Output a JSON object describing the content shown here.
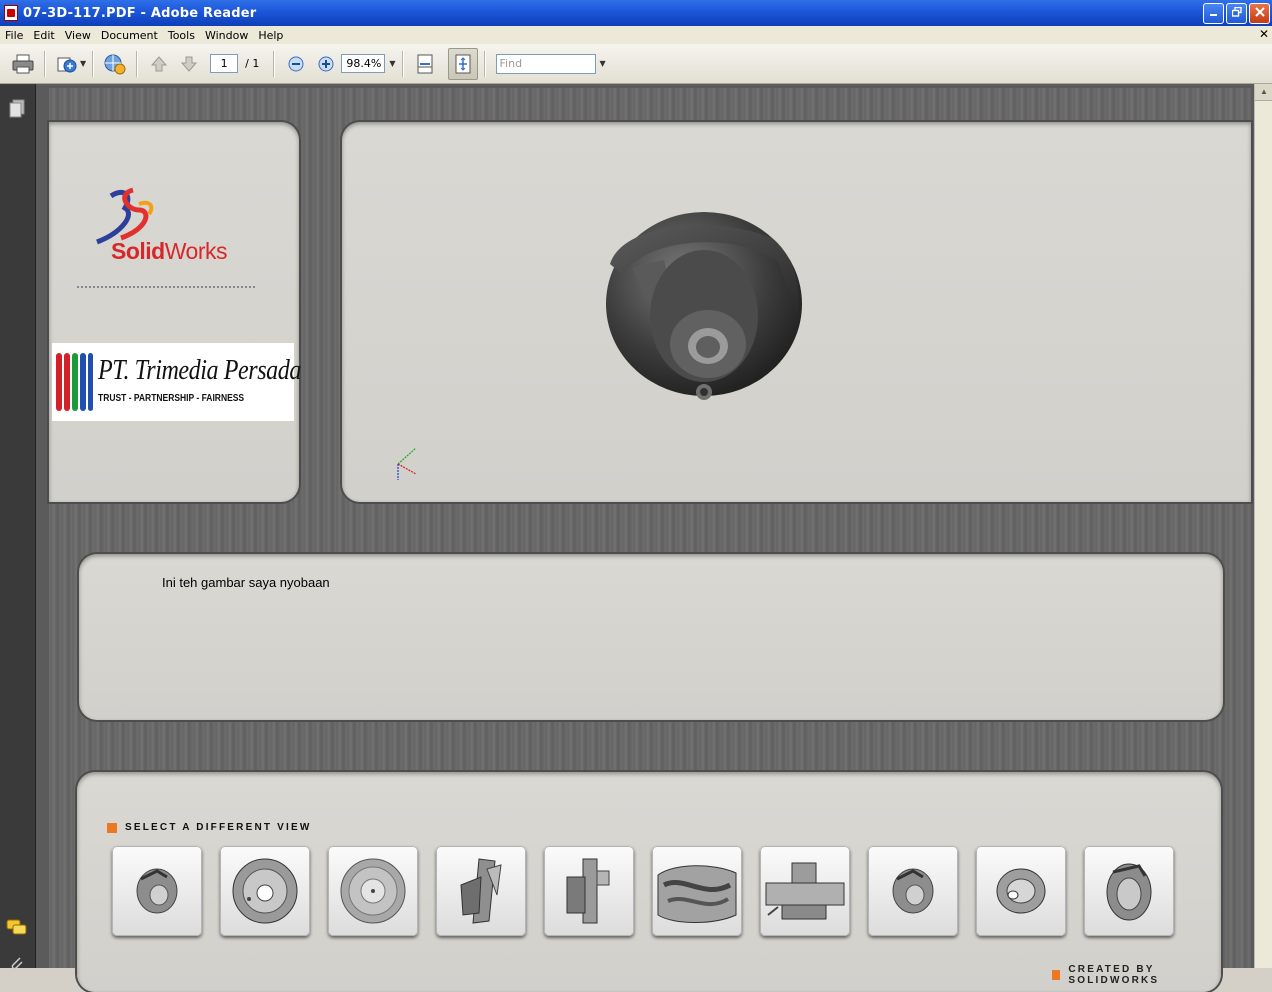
{
  "window": {
    "title": "07-3D-117.PDF - Adobe Reader",
    "buttons": [
      "minimize-icon",
      "restore-icon",
      "close-icon"
    ]
  },
  "menu": [
    "File",
    "Edit",
    "View",
    "Document",
    "Tools",
    "Window",
    "Help"
  ],
  "toolbar": {
    "page_current": "1",
    "page_total": "/ 1",
    "zoom": "98.4%",
    "find_placeholder": "Find"
  },
  "document": {
    "logo_brand": "SolidWorks",
    "logo_solid": "Solid",
    "logo_works": "Works",
    "company_name": "PT. Trimedia Persada",
    "company_tagline": "TRUST - PARTNERSHIP - FAIRNESS",
    "description": "Ini teh gambar saya nyobaan",
    "views_label": "SELECT A DIFFERENT VIEW",
    "credit_label": "CREATED BY SOLIDWORKS",
    "thumbnails": [
      "view-iso",
      "view-front",
      "view-back",
      "view-left",
      "view-right",
      "view-section-a",
      "view-section-b",
      "view-iso-2",
      "view-top",
      "view-bottom"
    ]
  },
  "colors": {
    "accent": "#ee7722",
    "brand_red": "#d8272a",
    "title_blue": "#1c56d9"
  }
}
